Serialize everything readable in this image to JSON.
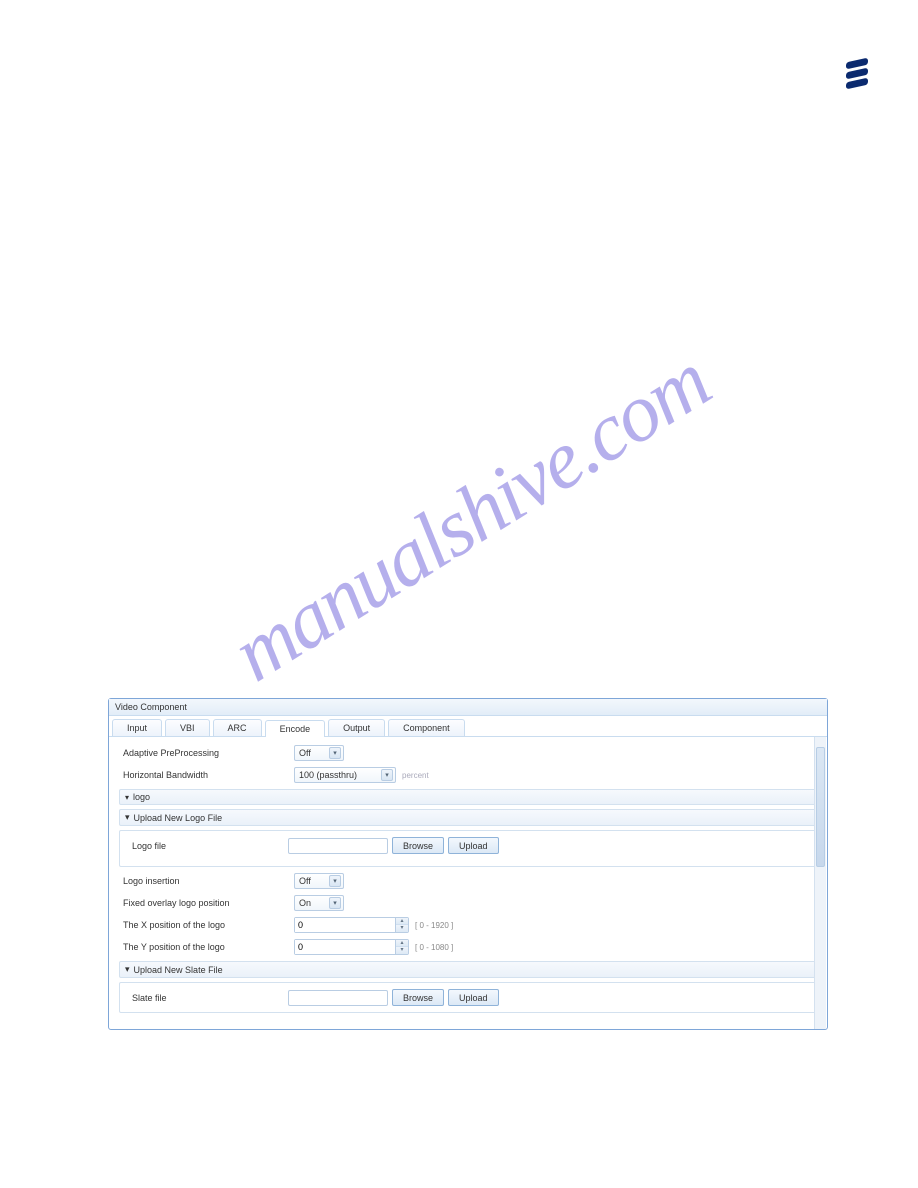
{
  "watermark": "manualshive.com",
  "panel": {
    "title": "Video Component"
  },
  "tabs": [
    "Input",
    "VBI",
    "ARC",
    "Encode",
    "Output",
    "Component"
  ],
  "active_tab": "Encode",
  "fields": {
    "adaptive": {
      "label": "Adaptive PreProcessing",
      "value": "Off"
    },
    "hbw": {
      "label": "Horizontal Bandwidth",
      "value": "100 (passthru)",
      "hint": "percent"
    }
  },
  "logo": {
    "header": "logo",
    "upload_header": "Upload New Logo File",
    "file_label": "Logo file",
    "file_value": "",
    "browse": "Browse",
    "upload": "Upload",
    "insertion": {
      "label": "Logo insertion",
      "value": "Off"
    },
    "fixed": {
      "label": "Fixed overlay logo position",
      "value": "On"
    },
    "xpos": {
      "label": "The X position of the logo",
      "value": "0",
      "range": "[ 0 - 1920 ]"
    },
    "ypos": {
      "label": "The Y position of the logo",
      "value": "0",
      "range": "[ 0 - 1080 ]"
    }
  },
  "slate": {
    "header": "Upload New Slate File",
    "file_label": "Slate file",
    "file_value": "",
    "browse": "Browse",
    "upload": "Upload"
  }
}
